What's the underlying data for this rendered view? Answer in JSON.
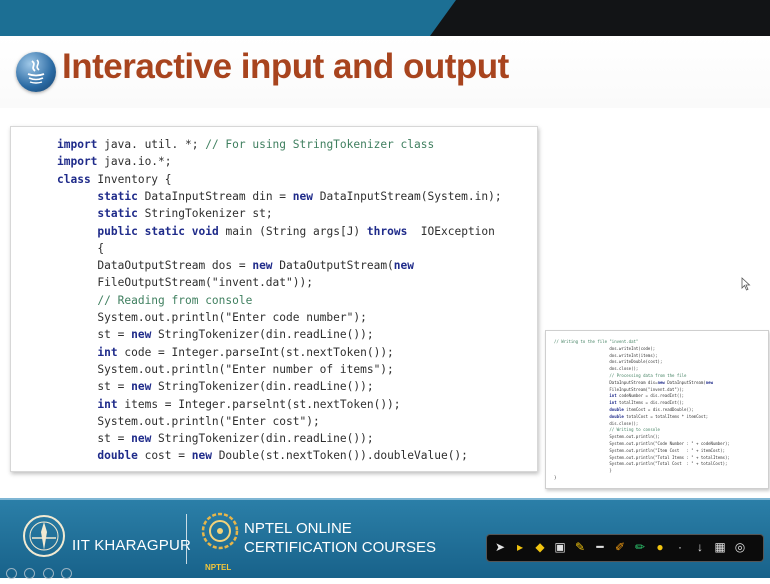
{
  "slide": {
    "title": "Interactive input and output",
    "code_main": [
      {
        "text": ""
      },
      {
        "text": ""
      },
      {
        "text": ""
      },
      {
        "text": ""
      },
      {
        "text": ""
      },
      {
        "text": ""
      },
      {
        "text": ""
      },
      {
        "text": ""
      },
      {
        "text": ""
      },
      {
        "text": ""
      },
      {
        "text": ""
      },
      {
        "text": ""
      },
      {
        "text": ""
      },
      {
        "text": ""
      },
      {
        "text": ""
      },
      {
        "text": ""
      },
      {
        "text": ""
      },
      {
        "text": ""
      },
      {
        "text": ""
      },
      {
        "text": ""
      }
    ],
    "code_lines": [
      "import java. util. *; // For using StringTokenizer class",
      "import java.io.*;",
      "class Inventory {",
      "      static DataInputStream din = new DataInputStream(System.in);",
      "      static StringTokenizer st;",
      "      public static void main (String args[J) throws  IOException",
      "      {",
      "      DataOutputStream dos = new DataOutputStream(new",
      "      FileOutputStream(\"invent.dat\"));",
      "      // Reading from console",
      "      System.out.println(\"Enter code number\");",
      "      st = new StringTokenizer(din.readLine());",
      "      int code = Integer.parseInt(st.nextToken());",
      "      System.out.println(\"Enter number of items\");",
      "      st = new StringTokenizer(din.readLine());",
      "      int items = Integer.parselnt(st.nextToken());",
      "      System.out.println(\"Enter cost\");",
      "      st = new StringTokenizer(din.readLine());",
      "      double cost = new Double(st.nextToken()).doubleValue();"
    ],
    "thumbnail_lines": [
      "// Writing to the file \"invent.dat\"",
      "                       dos.writeInt(code);",
      "                       dos.writeInt(items);",
      "                       dos.writeDouble(cost);",
      "                       dos.close();",
      "                       // Processing data from the file",
      "                       DataInputStream dis=new DataInputStream(new",
      "                       FileInputStream(\"invent.dat\"));",
      "                       int codeNumber = dis.readInt();",
      "                       int totalItems = dis.readInt();",
      "                       double itemCost = dis.readDouble();",
      "                       double totalCost = totalItems * itemCost;",
      "                       dis.close();",
      "                       // Writing to console",
      "                       System.out.println();",
      "                       System.out.println(\"Code Number : \" + codeNumber);",
      "                       System.out.println(\"Item Cost   : \" + itemCost);",
      "                       System.out.println(\"Total Items : \" + totalItems);",
      "                       System.out.println(\"Total Cost  : \" + totalCost);",
      "                       }",
      "}"
    ]
  },
  "footer": {
    "institute": "IIT KHARAGPUR",
    "course_line1": "NPTEL ONLINE",
    "course_line2": "CERTIFICATION COURSES",
    "nptel_label": "NPTEL"
  },
  "toolbar": {
    "tools": [
      "pointer-icon",
      "next-icon",
      "eraser-icon",
      "highlighter-icon",
      "pen-icon",
      "line-icon",
      "pencil-icon",
      "green-pen-icon",
      "marker-icon",
      "laser-icon",
      "text-icon",
      "screen-icon",
      "record-icon"
    ]
  },
  "colors": {
    "title": "#a8441e",
    "top_bar": "#1c6f94",
    "footer": "#18628a",
    "keyword": "#1f2b8a",
    "comment": "#3f7f5f"
  }
}
